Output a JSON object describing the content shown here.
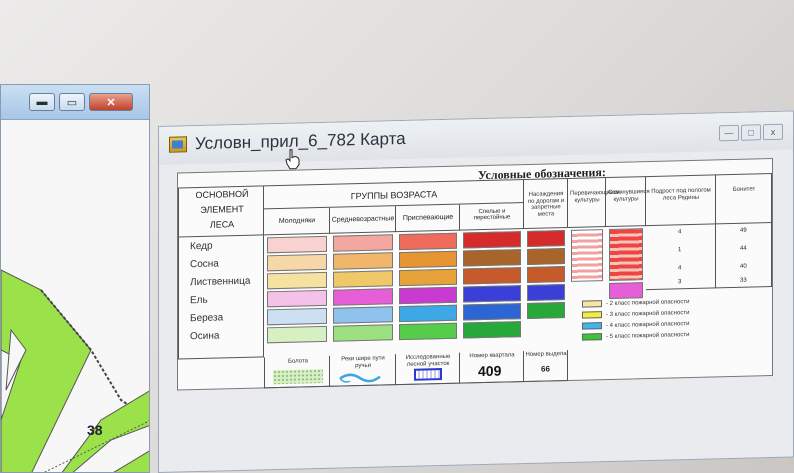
{
  "background_window": {
    "buttons": {
      "minimize": "▬",
      "maximize": "▭",
      "close": "✕"
    },
    "map_number": "38"
  },
  "main_window": {
    "title": "Условн_прил_6_782 Карта",
    "controls": {
      "minimize": "—",
      "maximize": "□",
      "close": "x"
    },
    "legend": {
      "title": "Условные обозначения:",
      "element_header": [
        "ОСНОВНОЙ",
        "ЭЛЕМЕНТ",
        "ЛЕСА"
      ],
      "age_groups_header": "ГРУППЫ ВОЗРАСТА",
      "age_groups": [
        "Молодняки",
        "Средневозрастные",
        "Приспевающие",
        "Спелые и перестойные"
      ],
      "extra_headers": [
        "Насаждения по дорогам и запретные места",
        "Перевичающиеся культуры",
        "Сомкнувшиеся культуры",
        "Подрост под пологом леса Редины",
        "Бонитет"
      ],
      "species": [
        "Кедр",
        "Сосна",
        "Лиственница",
        "Ель",
        "Береза",
        "Осина"
      ],
      "row_numbers": [
        "4",
        "1",
        "4",
        "3"
      ],
      "row_numbers_last": [
        "49",
        "44",
        "40",
        "33"
      ],
      "fire_classes": [
        {
          "label": "- 2 класс пожарной опасности",
          "color": "#f2e7a3"
        },
        {
          "label": "- 3 класс пожарной опасности",
          "color": "#f2ef3a"
        },
        {
          "label": "- 4 класс пожарной опасности",
          "color": "#3fb6e8"
        },
        {
          "label": "- 5 класс пожарной опасности",
          "color": "#39c43a"
        }
      ],
      "bottom": {
        "swamp": "Болота",
        "river": "Реки шире пути ручьи",
        "unit": "Исследованные лесной участок",
        "quarter_label": "Номер квартала",
        "quarter_value": "409",
        "plot_label": "Номер выдела",
        "plot_value": "66"
      }
    }
  }
}
